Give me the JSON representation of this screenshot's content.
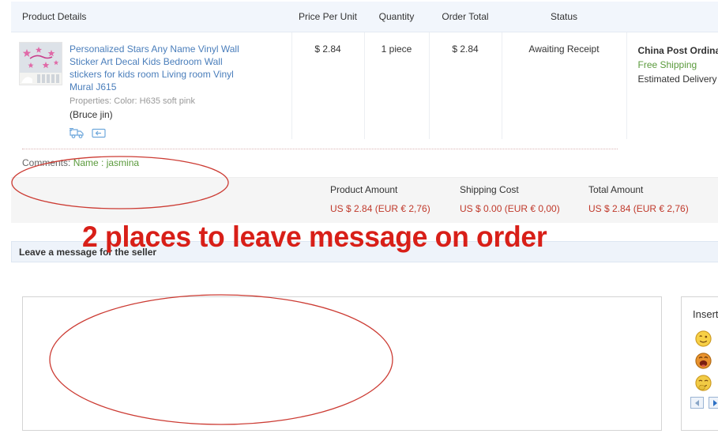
{
  "table": {
    "headers": {
      "product": "Product Details",
      "price": "Price Per Unit",
      "quantity": "Quantity",
      "order_total": "Order Total",
      "status": "Status"
    },
    "row": {
      "title": "Personalized Stars Any Name Vinyl Wall Sticker Art Decal Kids Bedroom Wall stickers for kids room Living room Vinyl Mural J615",
      "properties": "Properties: Color: H635 soft pink",
      "seller": "(Bruce jin)",
      "price_per_unit": "$ 2.84",
      "quantity": "1 piece",
      "order_total": "$ 2.84",
      "status": "Awaiting Receipt",
      "shipping_method": "China Post Ordinary Small Packet Plus",
      "shipping_cost_label": "Free Shipping",
      "estimated_delivery": "Estimated Delivery",
      "icons": {
        "shipping": "truck-icon",
        "returns": "return-arrow-icon"
      }
    },
    "comments": {
      "label": "Comments:",
      "value": "Name : jasmina"
    }
  },
  "totals": {
    "product_amount_label": "Product Amount",
    "product_amount_value": "US $ 2.84 (EUR € 2,76)",
    "shipping_cost_label": "Shipping Cost",
    "shipping_cost_value": "US $ 0.00 (EUR € 0,00)",
    "total_amount_label": "Total Amount",
    "total_amount_value": "US $ 2.84 (EUR € 2,76)"
  },
  "message_section": {
    "header": "Leave a message for the seller",
    "textarea_value": "",
    "textarea_placeholder": ""
  },
  "insert_panel": {
    "title": "Insert",
    "emoticons": [
      "smiley-wink-icon",
      "smiley-grin-icon",
      "smiley-laugh-icon",
      "smiley-open-mouth-icon",
      "smiley-cool-icon",
      "smiley-surprised-icon",
      "smiley-sly-icon",
      "smiley-happy-icon",
      "smiley-neutral-icon"
    ],
    "prev_label": "prev-page-icon",
    "next_label": "next-page-icon"
  },
  "annotation": {
    "text": "2 places to leave message on order",
    "color": "#d81f18"
  },
  "colors": {
    "link": "#4a7ebb",
    "price_red": "#c0392b",
    "free_shipping_green": "#5a9a3c",
    "header_bg": "#f2f6fc",
    "totals_bg": "#f5f5f5",
    "msg_header_bg": "#eef3fa"
  }
}
